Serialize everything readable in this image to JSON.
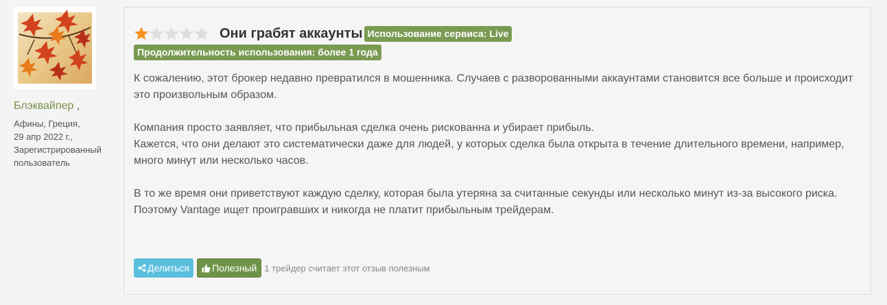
{
  "author": {
    "name": "Блэквайпер",
    "comma": " ,",
    "location": "Афины, Греция,",
    "date": "29 апр 2022 г.,",
    "status_line1": "Зарегистрированный",
    "status_line2": "пользователь",
    "avatar_icon": "autumn-leaves-avatar"
  },
  "review": {
    "rating": 1,
    "max_rating": 5,
    "colors": {
      "star_filled": "#f7931e",
      "star_empty": "#dddddd",
      "tag_bg": "#7a9a52"
    },
    "title": "Они грабят аккаунты",
    "tag_service": "Использование сервиса: Live",
    "tag_duration": "Продолжительность использования: более 1 года",
    "paragraphs": [
      "К сожалению, этот брокер недавно превратился в мошенника. Случаев с разворованными аккаунтами становится все больше и происходит это произвольным образом.",
      "Компания просто заявляет, что прибыльная сделка очень рискованна и убирает прибыль.\nКажется, что они делают это систематически даже для людей, у которых сделка была открыта в течение длительного времени, например, много минут или несколько часов.",
      "В то же время они приветствуют каждую сделку, которая была утеряна за считанные секунды или несколько минут из-за высокого риска.\nПоэтому Vantage ищет проигравших и никогда не платит прибыльным трейдерам."
    ]
  },
  "actions": {
    "share_label": "Делиться",
    "share_icon": "share-icon",
    "helpful_label": "Полезный",
    "helpful_icon": "thumbs-up-icon",
    "helpful_count_text": "1 трейдер считает этот отзыв полезным"
  }
}
